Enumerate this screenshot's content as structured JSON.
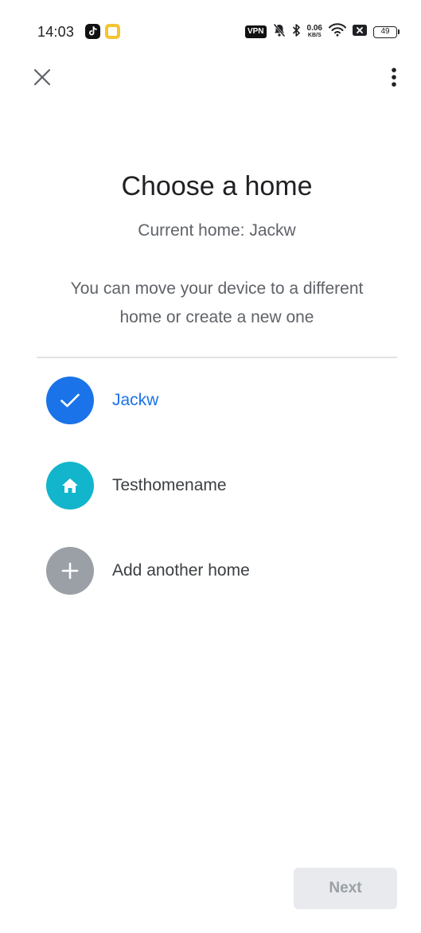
{
  "status_bar": {
    "time": "14:03",
    "vpn_label": "VPN",
    "net_speed_value": "0.06",
    "net_speed_unit": "KB/S",
    "battery_level": "49",
    "icons": [
      "tiktok-icon",
      "notes-icon",
      "mute-bell-icon",
      "bluetooth-icon",
      "wifi-icon",
      "sim-off-icon",
      "battery-icon"
    ]
  },
  "toolbar": {
    "close_icon": "close-icon",
    "menu_icon": "more-vert-icon"
  },
  "header": {
    "title": "Choose a home",
    "current_home": "Current home: Jackw",
    "description": "You can move your device to a different home or create a new one"
  },
  "homes": [
    {
      "label": "Jackw",
      "icon": "check-icon",
      "selected": true
    },
    {
      "label": "Testhomename",
      "icon": "home-icon",
      "selected": false
    },
    {
      "label": "Add another home",
      "icon": "plus-icon",
      "selected": false
    }
  ],
  "footer": {
    "next_label": "Next"
  },
  "colors": {
    "accent": "#1a73e8",
    "home_teal": "#12b5cb",
    "add_gray": "#9aa0a6",
    "disabled_bg": "#e8eaed"
  }
}
